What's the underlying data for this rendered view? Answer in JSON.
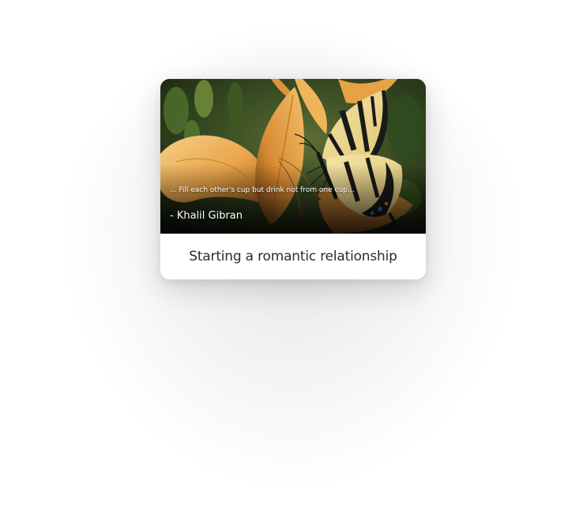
{
  "card": {
    "quote": "... Fill each other's cup but drink not from one cup...",
    "author": "- Khalil Gibran",
    "title": "Starting a romantic relationship",
    "image_subject": "butterfly-on-lily"
  },
  "colors": {
    "background": "#ffffff",
    "card_background": "#ffffff",
    "title_text": "#2b2b2b",
    "overlay_text": "#ffffff",
    "petal": "#e6a24a",
    "foliage": "#3c5a2c"
  }
}
